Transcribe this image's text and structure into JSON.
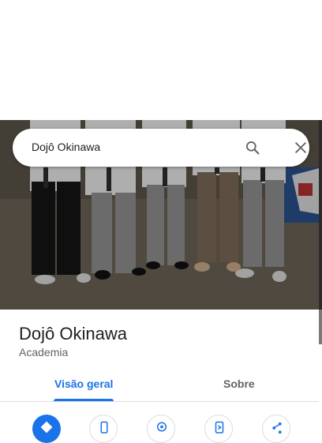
{
  "search": {
    "query": "Dojô Okinawa"
  },
  "place": {
    "name": "Dojô Okinawa",
    "category": "Academia"
  },
  "tabs": [
    {
      "label": "Visão geral",
      "selected": true
    },
    {
      "label": "Sobre",
      "selected": false
    }
  ],
  "actions": [
    {
      "icon": "directions-icon"
    },
    {
      "icon": "phone-icon"
    },
    {
      "icon": "location-pin-icon"
    },
    {
      "icon": "send-to-phone-icon"
    },
    {
      "icon": "share-icon"
    }
  ],
  "colors": {
    "accent": "#1a73e8",
    "text_primary": "#202124",
    "text_secondary": "#5f6368"
  }
}
